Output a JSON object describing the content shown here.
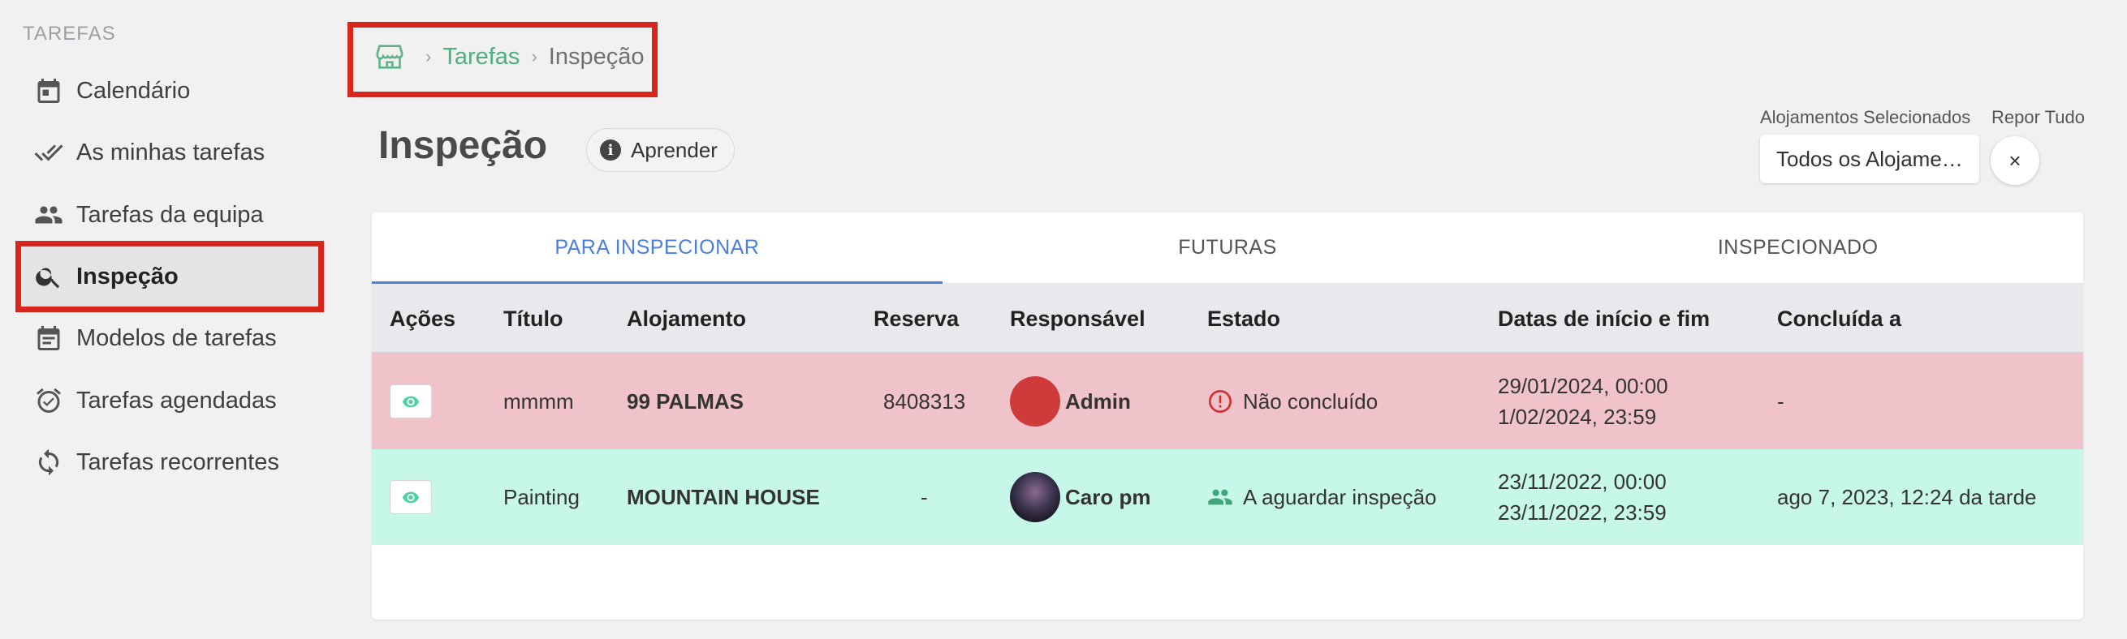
{
  "sidebar": {
    "heading": "TAREFAS",
    "items": [
      {
        "label": "Calendário",
        "icon": "calendar-icon"
      },
      {
        "label": "As minhas tarefas",
        "icon": "double-check-icon"
      },
      {
        "label": "Tarefas da equipa",
        "icon": "people-icon"
      },
      {
        "label": "Inspeção",
        "icon": "search-icon",
        "active": true
      },
      {
        "label": "Modelos de tarefas",
        "icon": "template-icon"
      },
      {
        "label": "Tarefas agendadas",
        "icon": "alarm-check-icon"
      },
      {
        "label": "Tarefas recorrentes",
        "icon": "sync-icon"
      }
    ]
  },
  "breadcrumb": {
    "home_icon": "home-store-icon",
    "link": "Tarefas",
    "current": "Inspeção"
  },
  "page": {
    "title": "Inspeção",
    "learn_label": "Aprender"
  },
  "filters": {
    "accommodations_label": "Alojamentos Selecionados",
    "accommodations_value": "Todos os Alojame…",
    "reset_label": "Repor Tudo",
    "reset_symbol": "×"
  },
  "tabs": [
    {
      "label": "PARA INSPECIONAR",
      "active": true
    },
    {
      "label": "FUTURAS",
      "active": false
    },
    {
      "label": "INSPECIONADO",
      "active": false
    }
  ],
  "table": {
    "headers": [
      "Ações",
      "Título",
      "Alojamento",
      "Reserva",
      "Responsável",
      "Estado",
      "Datas de início e fim",
      "Concluída a"
    ],
    "rows": [
      {
        "title": "mmmm",
        "accommodation": "99 PALMAS",
        "reservation": "8408313",
        "responsible": "Admin",
        "status": "Não concluído",
        "status_icon": "alert-circle-icon",
        "start": "29/01/2024, 00:00",
        "end": "1/02/2024, 23:59",
        "completed": "-",
        "row_color": "#f0c3cb"
      },
      {
        "title": "Painting",
        "accommodation": "MOUNTAIN HOUSE",
        "reservation": "-",
        "responsible": "Caro pm",
        "status": "A aguardar inspeção",
        "status_icon": "people-icon",
        "start": "23/11/2022, 00:00",
        "end": "23/11/2022, 23:59",
        "completed": "ago 7, 2023, 12:24 da tarde",
        "row_color": "#c7f7e8"
      }
    ]
  },
  "colors": {
    "accent_blue": "#4a7fe0",
    "accent_green": "#4caf7f",
    "highlight_red": "#d9261c"
  }
}
